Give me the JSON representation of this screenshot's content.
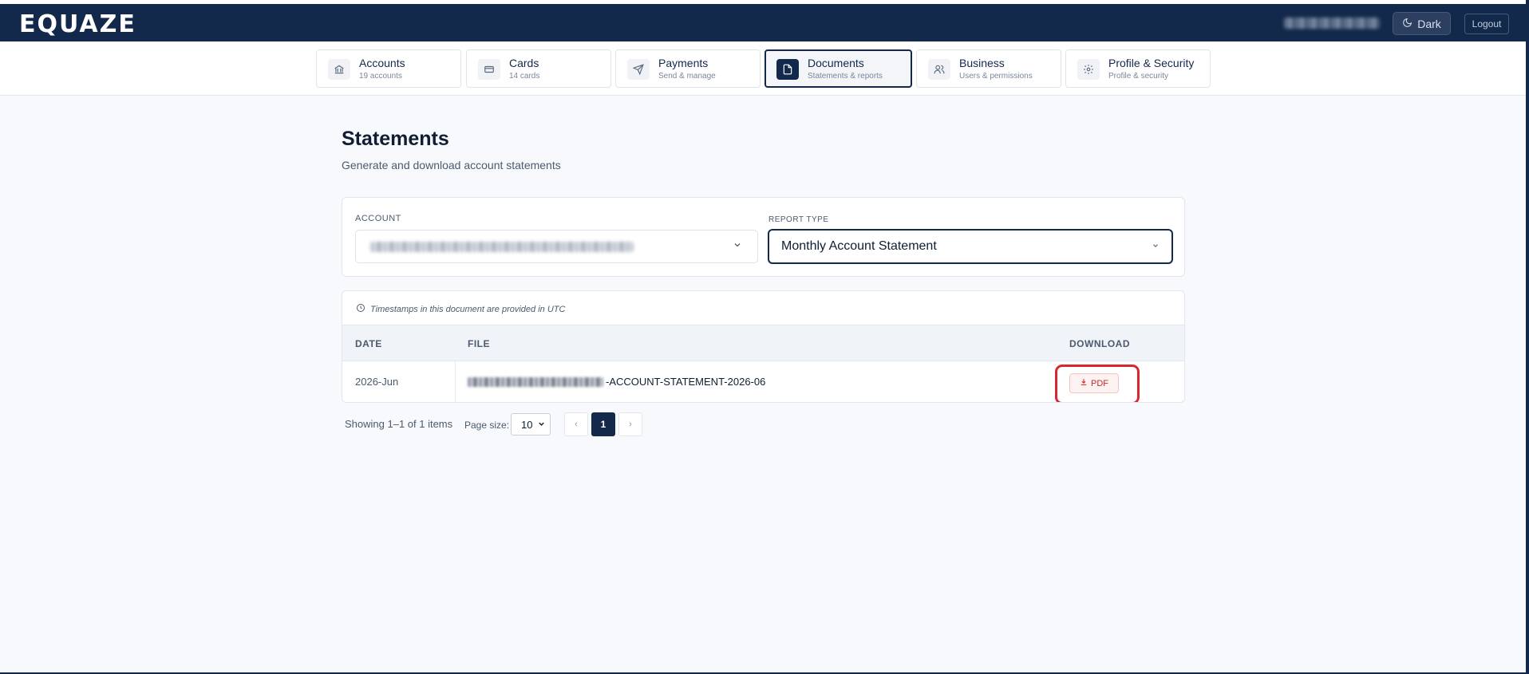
{
  "app": {
    "logo_text": "EQUAZE",
    "dark_label": "Dark",
    "logout_label": "Logout"
  },
  "tabs": [
    {
      "title": "Accounts",
      "subtitle": "19 accounts",
      "icon": "bank-icon"
    },
    {
      "title": "Cards",
      "subtitle": "14 cards",
      "icon": "card-icon"
    },
    {
      "title": "Payments",
      "subtitle": "Send & manage",
      "icon": "send-icon"
    },
    {
      "title": "Documents",
      "subtitle": "Statements & reports",
      "icon": "document-icon",
      "active": true
    },
    {
      "title": "Business",
      "subtitle": "Users & permissions",
      "icon": "users-icon"
    },
    {
      "title": "Profile & Security",
      "subtitle": "Profile & security",
      "icon": "gear-icon"
    }
  ],
  "page": {
    "title": "Statements",
    "subtitle": "Generate and download account statements"
  },
  "filters": {
    "account_label": "ACCOUNT",
    "report_type_label": "REPORT TYPE",
    "report_type_value": "Monthly Account Statement"
  },
  "table": {
    "timezone_note": "Timestamps in this document are provided in UTC",
    "headers": {
      "date": "DATE",
      "file": "FILE",
      "download": "DOWNLOAD"
    },
    "rows": [
      {
        "date": "2026-Jun",
        "file_suffix": "-ACCOUNT-STATEMENT-2026-06",
        "download_label": "PDF"
      }
    ]
  },
  "pagination": {
    "summary": "Showing 1–1 of 1 items",
    "page_size_label": "Page size:",
    "page_size": "10",
    "prev": "‹",
    "next": "›",
    "current_page": "1"
  },
  "colors": {
    "navy": "#13294b",
    "highlight_red": "#d9272e",
    "pdf_red": "#c62828"
  }
}
